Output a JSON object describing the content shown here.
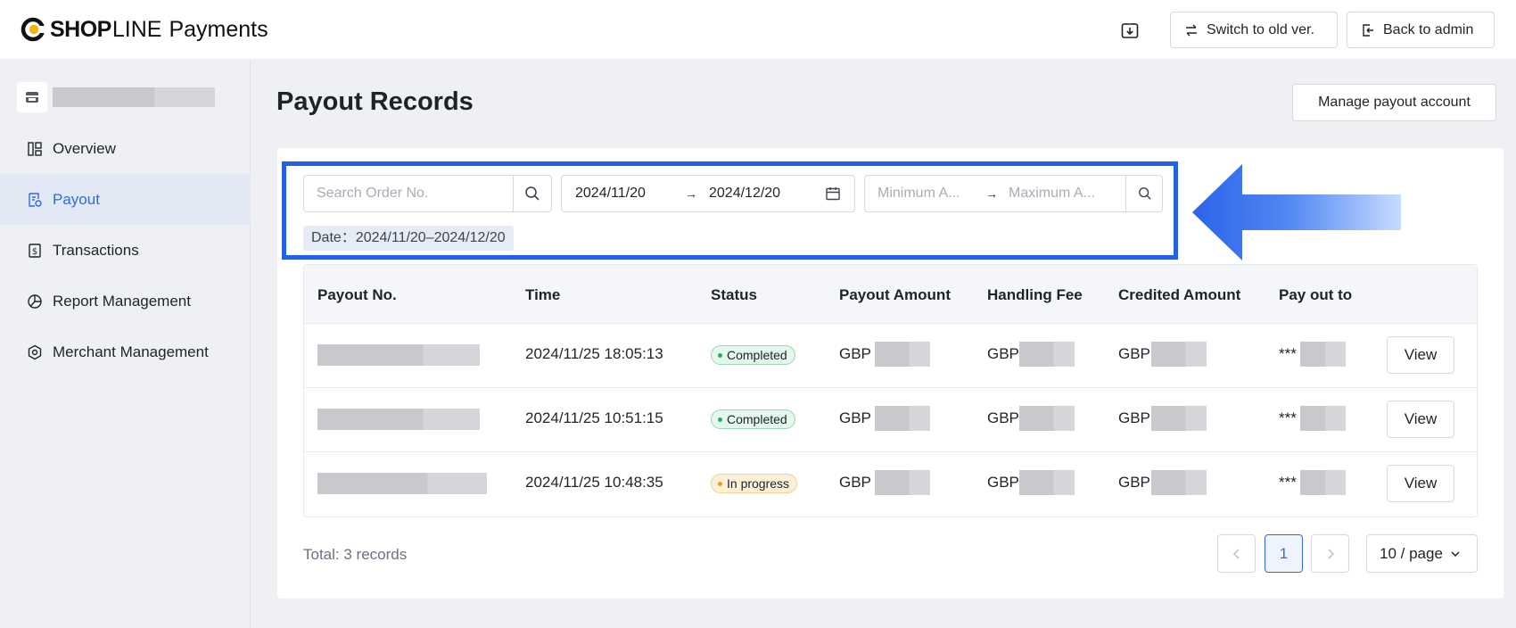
{
  "header": {
    "brand_bold": "SHOP",
    "brand_light": "LINE",
    "brand_product": "Payments",
    "download_icon": "download-icon",
    "switch_label": "Switch to old ver.",
    "back_label": "Back to admin"
  },
  "sidebar": {
    "store_icon": "store-icon",
    "items": [
      {
        "label": "Overview",
        "icon": "overview-icon",
        "active": false
      },
      {
        "label": "Payout",
        "icon": "payout-icon",
        "active": true
      },
      {
        "label": "Transactions",
        "icon": "transactions-icon",
        "active": false
      },
      {
        "label": "Report Management",
        "icon": "report-icon",
        "active": false
      },
      {
        "label": "Merchant Management",
        "icon": "merchant-icon",
        "active": false
      }
    ]
  },
  "main": {
    "title": "Payout Records",
    "manage_label": "Manage payout account",
    "filters": {
      "search_placeholder": "Search Order No.",
      "date_start": "2024/11/20",
      "date_end": "2024/12/20",
      "range_arrow": "→",
      "min_amount_placeholder": "Minimum A...",
      "max_amount_placeholder": "Maximum A...",
      "date_tag": "Date：2024/11/20–2024/12/20"
    },
    "table": {
      "columns": [
        "Payout No.",
        "Time",
        "Status",
        "Payout Amount",
        "Handling Fee",
        "Credited Amount",
        "Pay out to"
      ],
      "rows": [
        {
          "time": "2024/11/25 18:05:13",
          "status": "Completed",
          "status_type": "completed",
          "amount_cur": "GBP",
          "fee_cur": "GBP",
          "credited_cur": "GBP",
          "account_prefix": "***",
          "action": "View"
        },
        {
          "time": "2024/11/25 10:51:15",
          "status": "Completed",
          "status_type": "completed",
          "amount_cur": "GBP",
          "fee_cur": "GBP",
          "credited_cur": "GBP",
          "account_prefix": "***",
          "action": "View"
        },
        {
          "time": "2024/11/25 10:48:35",
          "status": "In progress",
          "status_type": "progress",
          "amount_cur": "GBP",
          "fee_cur": "GBP",
          "credited_cur": "GBP",
          "account_prefix": "***",
          "action": "View"
        }
      ]
    },
    "pagination": {
      "total": "Total: 3 records",
      "current_page": "1",
      "page_size": "10 / page"
    }
  },
  "colors": {
    "accent": "#2d6be4",
    "highlight": "#2360e6",
    "completed": "#2aa863",
    "in_progress": "#f29b1b"
  }
}
